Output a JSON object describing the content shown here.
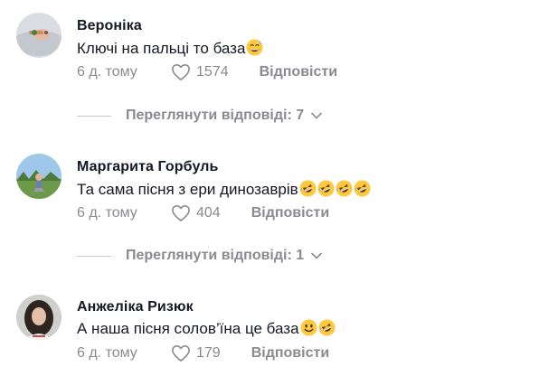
{
  "comments": [
    {
      "author": "Вероніка",
      "text": "Ключі на пальці то база",
      "emojis": [
        "grinning-sweat-emoji"
      ],
      "time": "6 д. тому",
      "likes": "1574",
      "reply_label": "Відповісти",
      "view_replies": "Переглянути відповіді: 7"
    },
    {
      "author": "Маргарита Горбуль",
      "text": "Та сама пісня з ери динозаврів",
      "emojis": [
        "rofl-emoji",
        "rofl-emoji",
        "rofl-emoji",
        "rofl-emoji"
      ],
      "time": "6 д. тому",
      "likes": "404",
      "reply_label": "Відповісти",
      "view_replies": "Переглянути відповіді: 1"
    },
    {
      "author": "Анжеліка Ризюк",
      "text": "А наша пісня солов’їна це база",
      "emojis": [
        "smiling-face-emoji",
        "rofl-emoji"
      ],
      "time": "6 д. тому",
      "likes": "179",
      "reply_label": "Відповісти"
    }
  ],
  "colors": {
    "text": "#161823",
    "muted": "#8a8b91",
    "emoji": "#ffc83d"
  }
}
